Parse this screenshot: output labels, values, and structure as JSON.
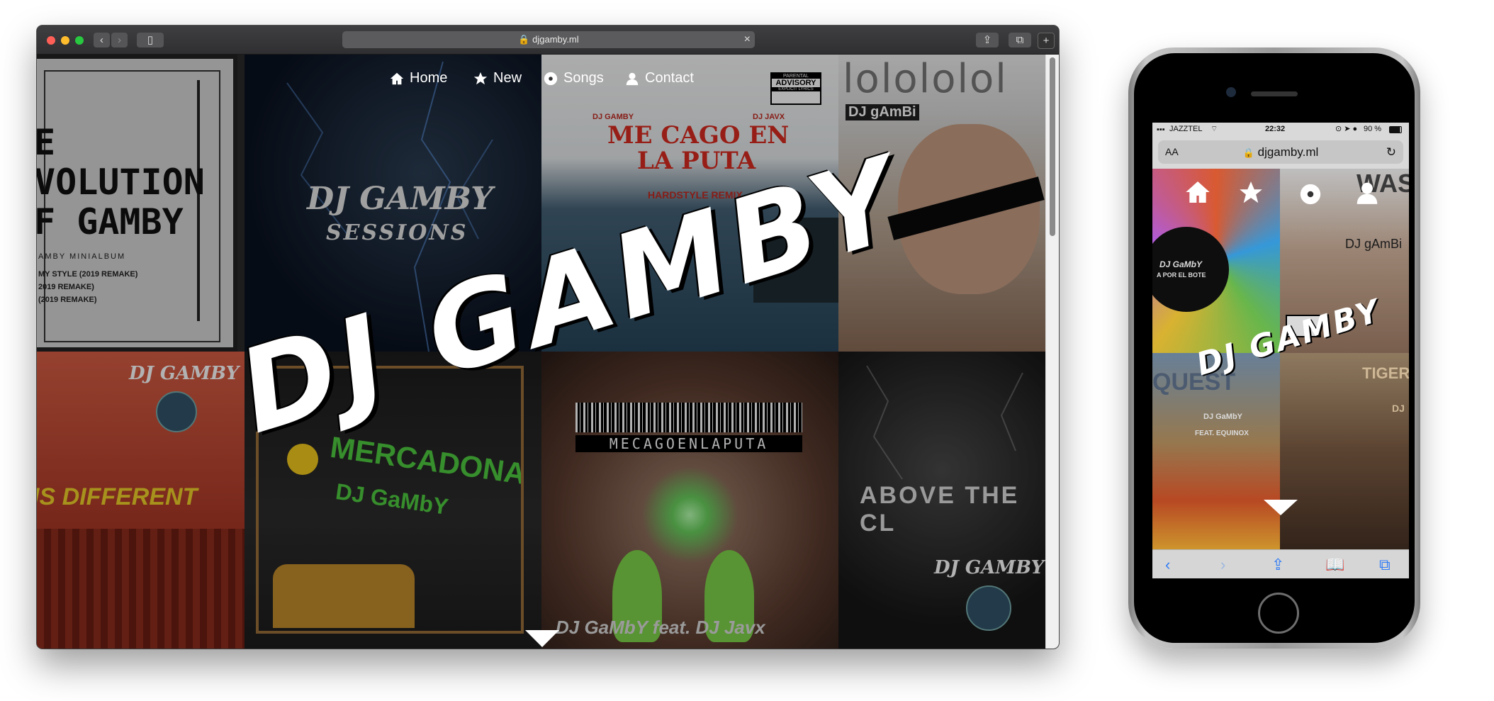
{
  "desktop": {
    "url": "djgamby.ml",
    "nav": [
      {
        "label": "Home",
        "icon": "home-icon"
      },
      {
        "label": "New",
        "icon": "star-icon"
      },
      {
        "label": "Songs",
        "icon": "disc-icon"
      },
      {
        "label": "Contact",
        "icon": "user-icon"
      }
    ],
    "brand": "DJ GAMBY",
    "covers": {
      "evolution": {
        "title": "E\nVOLUTION\nF GAMBY",
        "subtitle": "AMBY MINIALBUM",
        "tracks": [
          "MY STYLE (2019 REMAKE)",
          "2019 REMAKE)",
          "(2019 REMAKE)"
        ]
      },
      "sessions": {
        "line1": "DJ GAMBY",
        "line2": "SESSIONS"
      },
      "sea": {
        "artist_left": "DJ GAMBY",
        "artist_right": "DJ JAVX",
        "title1": "ME CAGO EN",
        "title2": "LA PUTA",
        "remix": "HARDSTYLE REMIX",
        "advisory_top": "PARENTAL",
        "advisory_mid": "ADVISORY",
        "advisory_bot": "EXPLICIT LYRICS"
      },
      "lol": {
        "header": "lolololol",
        "label": "DJ gAmBi"
      },
      "different": {
        "artist": "DJ GAMBY",
        "title": "IS DIFFERENT"
      },
      "mercadona": {
        "line1": "MERCADONA",
        "line2": "DJ GaMbY"
      },
      "barcode": {
        "text": "MECAGOENLAPUTA",
        "footer": "DJ GaMbY feat. DJ Javx"
      },
      "cloud": {
        "title": "ABOVE THE CL",
        "artist": "DJ GAMBY"
      }
    }
  },
  "mobile": {
    "carrier": "JAZZTEL",
    "time": "22:32",
    "battery": "90 %",
    "url": "djgamby.ml",
    "aa": "AA",
    "brand": "DJ GAMBY",
    "covers": {
      "wheel_title": "DJ GaMbY",
      "wheel_sub": "A POR EL BOTE",
      "wasd_header": "WASD",
      "wasd_label": "DJ gAmBi",
      "quest_title": "QUEST",
      "quest_artist": "DJ GaMbY",
      "quest_feat": "FEAT. EQUINOX",
      "tiger_title": "TIGER",
      "tiger_artist": "DJ"
    }
  },
  "colors": {
    "accent": "#ffffff",
    "dark": "#000000",
    "red_title": "#d92b20",
    "mercadona_green": "#4fcc40"
  }
}
